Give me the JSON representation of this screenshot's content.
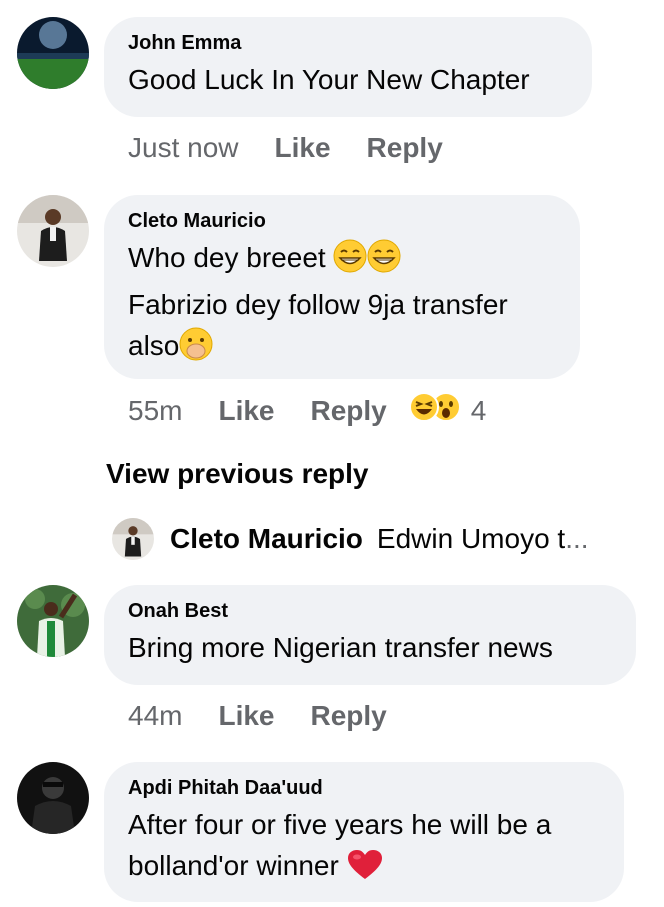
{
  "comments": [
    {
      "author": "John Emma",
      "line1": "Good Luck In Your New Chapter",
      "time": "Just now",
      "like": "Like",
      "reply": "Reply"
    },
    {
      "author": "Cleto Mauricio",
      "line1": "Who dey breeet",
      "line2": "Fabrizio dey follow 9ja transfer",
      "line3": "also",
      "time": "55m",
      "like": "Like",
      "reply": "Reply",
      "reaction_count": "4",
      "reactions": [
        "haha-icon",
        "wow-icon"
      ]
    },
    {
      "author": "Onah Best",
      "line1": "Bring more Nigerian transfer news",
      "time": "44m",
      "like": "Like",
      "reply": "Reply"
    },
    {
      "author": "Apdi Phitah Daa'uud",
      "line1": "After four or five years he will be a",
      "line2": "bolland'or winner",
      "emoji": "heart-icon"
    }
  ],
  "view_previous": "View previous reply",
  "reply_preview": {
    "name": "Cleto Mauricio",
    "text": "Edwin Umoyo t",
    "ellipsis": "..."
  },
  "colors": {
    "bubble": "#f0f2f5",
    "meta": "#65676b",
    "text": "#050505"
  }
}
